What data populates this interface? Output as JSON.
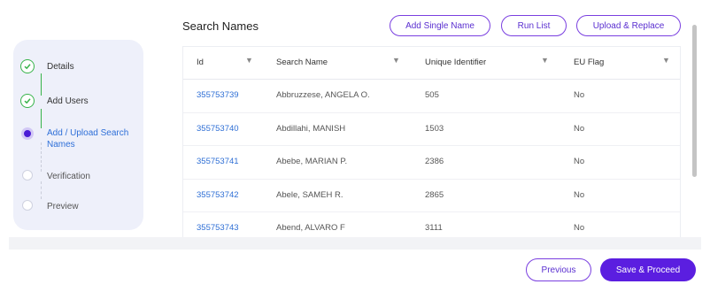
{
  "stepper": {
    "steps": [
      {
        "label": "Details",
        "state": "done"
      },
      {
        "label": "Add Users",
        "state": "done"
      },
      {
        "label": "Add / Upload Search Names",
        "state": "active"
      },
      {
        "label": "Verification",
        "state": "todo"
      },
      {
        "label": "Preview",
        "state": "todo"
      }
    ]
  },
  "header": {
    "title": "Search Names",
    "add_single_name": "Add Single Name",
    "run_list": "Run List",
    "upload_replace": "Upload & Replace"
  },
  "table": {
    "columns": [
      "Id",
      "Search Name",
      "Unique Identifier",
      "EU Flag"
    ],
    "rows": [
      {
        "id": "355753739",
        "name": "Abbruzzese, ANGELA O.",
        "uid": "505",
        "eu": "No"
      },
      {
        "id": "355753740",
        "name": "Abdillahi, MANISH",
        "uid": "1503",
        "eu": "No"
      },
      {
        "id": "355753741",
        "name": "Abebe, MARIAN P.",
        "uid": "2386",
        "eu": "No"
      },
      {
        "id": "355753742",
        "name": "Abele, SAMEH R.",
        "uid": "2865",
        "eu": "No"
      },
      {
        "id": "355753743",
        "name": "Abend, ALVARO F",
        "uid": "3111",
        "eu": "No"
      }
    ]
  },
  "footer": {
    "previous": "Previous",
    "save_proceed": "Save & Proceed"
  },
  "colors": {
    "accent": "#5b1ee0",
    "done": "#37b34a",
    "link": "#2f6fd5"
  }
}
